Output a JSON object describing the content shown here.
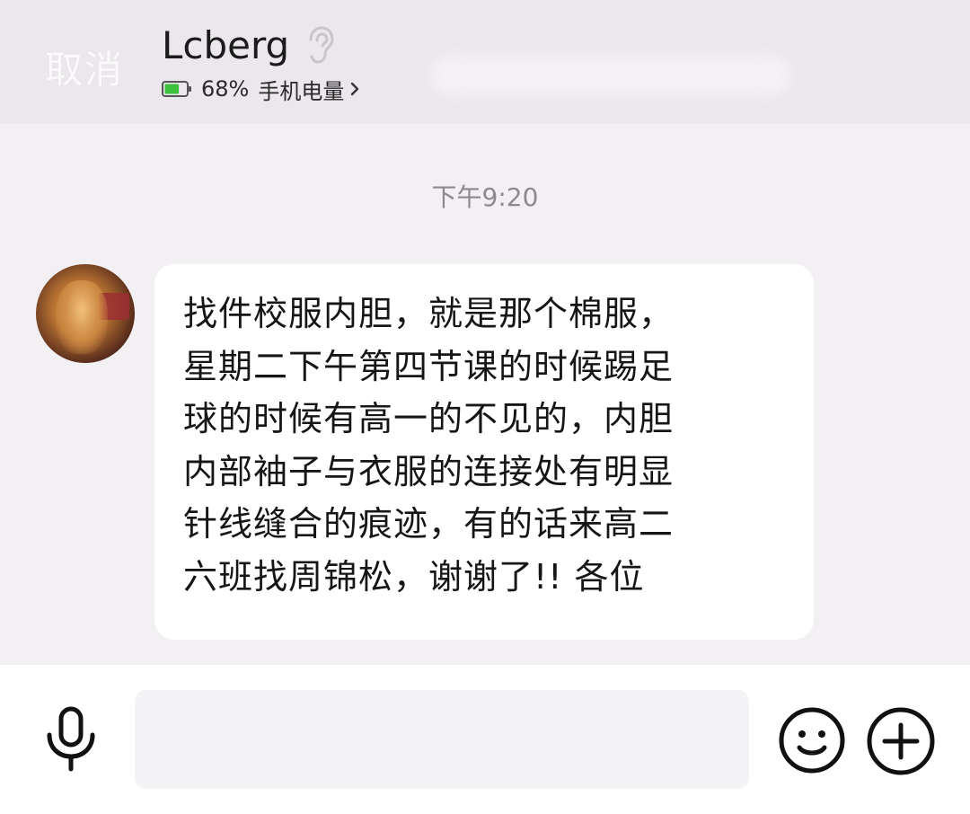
{
  "header": {
    "cancel_label": "取消",
    "contact_name": "Lcberg",
    "battery_percent": "68%",
    "battery_label": "手机电量",
    "battery_level": 0.68
  },
  "timestamp": "下午9:20",
  "message": {
    "text": "找件校服内胆，就是那个棉服，\n星期二下午第四节课的时候踢足\n球的时候有高一的不见的，内胆\n内部袖子与衣服的连接处有明显\n针线缝合的痕迹，有的话来高二\n六班找周锦松，谢谢了!! 各位"
  },
  "icons": {
    "ear": "ear-icon",
    "battery": "battery-icon",
    "chevron": "chevron-right-icon",
    "mic": "microphone-icon",
    "emoji": "emoji-icon",
    "plus": "plus-icon"
  },
  "colors": {
    "header_bg": "#ebe7ec",
    "chat_bg": "#f3f0f4",
    "bubble_bg": "#ffffff",
    "battery_green": "#3cc23c"
  }
}
